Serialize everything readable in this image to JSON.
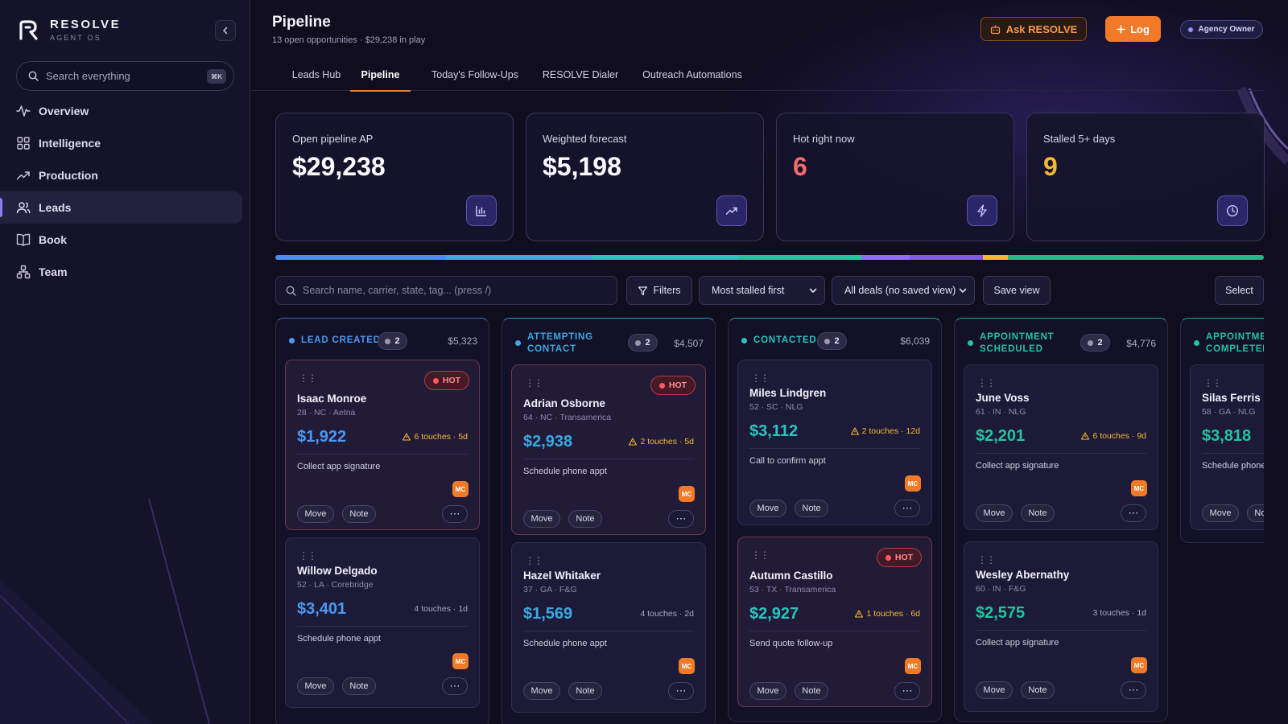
{
  "app": {
    "name": "RESOLVE",
    "subtitle": "AGENT OS"
  },
  "sidebar": {
    "search_placeholder": "Search everything",
    "search_shortcut": "⌘K",
    "items": [
      {
        "label": "Overview",
        "icon": "activity-icon"
      },
      {
        "label": "Intelligence",
        "icon": "grid-icon"
      },
      {
        "label": "Production",
        "icon": "trending-up-icon"
      },
      {
        "label": "Leads",
        "icon": "users-icon",
        "active": true
      },
      {
        "label": "Book",
        "icon": "book-icon"
      },
      {
        "label": "Team",
        "icon": "team-icon"
      }
    ]
  },
  "header": {
    "title": "Pipeline",
    "subtitle": "13 open opportunities · $29,238 in play",
    "ask_label": "Ask RESOLVE",
    "log_label": "Log",
    "role_label": "Agency Owner"
  },
  "tabs": [
    {
      "label": "Leads Hub"
    },
    {
      "label": "Pipeline",
      "active": true
    },
    {
      "label": "Today's Follow-Ups"
    },
    {
      "label": "RESOLVE Dialer"
    },
    {
      "label": "Outreach Automations"
    }
  ],
  "stats": [
    {
      "label": "Open pipeline AP",
      "value": "$29,238",
      "color": "#fbfaff",
      "icon": "bar-chart-icon"
    },
    {
      "label": "Weighted forecast",
      "value": "$5,198",
      "color": "#fbfaff",
      "icon": "trend-icon"
    },
    {
      "label": "Hot right now",
      "value": "6",
      "color": "#f36a6a",
      "icon": "bolt-icon"
    },
    {
      "label": "Stalled 5+ days",
      "value": "9",
      "color": "#f5b731",
      "icon": "clock-icon"
    }
  ],
  "stage_bar_colors": [
    "#4a8cf0",
    "#3aa9e0",
    "#2ac3c0",
    "#22c4a0",
    "#8f6cf0",
    "#7d5ae8",
    "#f5b731",
    "#22b888"
  ],
  "toolbar": {
    "search_placeholder": "Search name, carrier, state, tag... (press /)",
    "filters_label": "Filters",
    "sort_value": "Most stalled first",
    "view_value": "All deals (no saved view)",
    "save_view_label": "Save view",
    "select_label": "Select"
  },
  "columns": [
    {
      "name": "LEAD CREATED",
      "count": "2",
      "sum": "$5,323",
      "color": "#4a9af5",
      "cards": [
        {
          "name": "Isaac Monroe",
          "meta": "28 · NC · Aetna",
          "amount": "$1,922",
          "touches": "6 touches · 5d",
          "warn": true,
          "task": "Collect app signature",
          "hot": true,
          "hot_label": "HOT",
          "badge": "MC",
          "move": "Move",
          "note": "Note"
        },
        {
          "name": "Willow Delgado",
          "meta": "52 · LA · Corebridge",
          "amount": "$3,401",
          "touches": "4 touches · 1d",
          "warn": false,
          "task": "Schedule phone appt",
          "hot": false,
          "badge": "MC",
          "move": "Move",
          "note": "Note"
        }
      ]
    },
    {
      "name": "ATTEMPTING CONTACT",
      "count": "2",
      "sum": "$4,507",
      "color": "#3aa9e0",
      "cards": [
        {
          "name": "Adrian Osborne",
          "meta": "64 · NC · Transamerica",
          "amount": "$2,938",
          "touches": "2 touches · 5d",
          "warn": true,
          "task": "Schedule phone appt",
          "hot": true,
          "hot_label": "HOT",
          "badge": "MC",
          "move": "Move",
          "note": "Note"
        },
        {
          "name": "Hazel Whitaker",
          "meta": "37 · GA · F&G",
          "amount": "$1,569",
          "touches": "4 touches · 2d",
          "warn": false,
          "task": "Schedule phone appt",
          "hot": false,
          "badge": "MC",
          "move": "Move",
          "note": "Note"
        }
      ]
    },
    {
      "name": "CONTACTED",
      "count": "2",
      "sum": "$6,039",
      "color": "#2ac3c0",
      "cards": [
        {
          "name": "Miles Lindgren",
          "meta": "52 · SC · NLG",
          "amount": "$3,112",
          "touches": "2 touches · 12d",
          "warn": true,
          "task": "Call to confirm appt",
          "hot": false,
          "badge": "MC",
          "move": "Move",
          "note": "Note"
        },
        {
          "name": "Autumn Castillo",
          "meta": "53 · TX · Transamerica",
          "amount": "$2,927",
          "touches": "1 touches · 6d",
          "warn": true,
          "task": "Send quote follow-up",
          "hot": true,
          "hot_label": "HOT",
          "badge": "MC",
          "move": "Move",
          "note": "Note"
        }
      ]
    },
    {
      "name": "APPOINTMENT SCHEDULED",
      "count": "2",
      "sum": "$4,776",
      "color": "#22c4a0",
      "cards": [
        {
          "name": "June Voss",
          "meta": "61 · IN · NLG",
          "amount": "$2,201",
          "touches": "6 touches · 9d",
          "warn": true,
          "task": "Collect app signature",
          "hot": false,
          "badge": "MC",
          "move": "Move",
          "note": "Note"
        },
        {
          "name": "Wesley Abernathy",
          "meta": "60 · IN · F&G",
          "amount": "$2,575",
          "touches": "3 touches · 1d",
          "warn": false,
          "task": "Collect app signature",
          "hot": false,
          "badge": "MC",
          "move": "Move",
          "note": "Note"
        }
      ]
    },
    {
      "name": "APPOINTMENT COMPLETED",
      "count": "",
      "sum": "",
      "color": "#22c4a0",
      "cards": [
        {
          "name": "Silas Ferris",
          "meta": "58 · GA · NLG",
          "amount": "$3,818",
          "touches": "",
          "warn": false,
          "task": "Schedule phone appt",
          "hot": false,
          "badge": "",
          "move": "Move",
          "note": "Note"
        }
      ]
    }
  ]
}
